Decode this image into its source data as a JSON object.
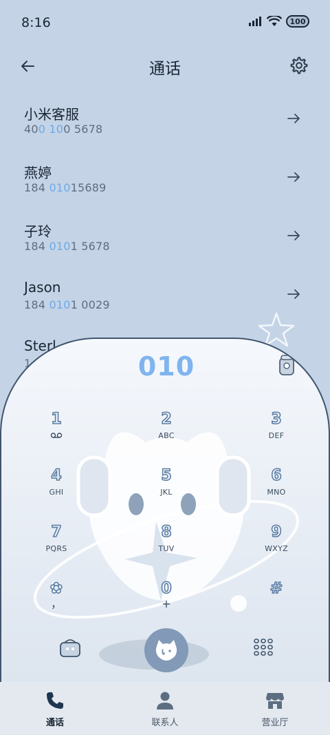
{
  "status": {
    "time": "8:16",
    "battery": "100"
  },
  "header": {
    "title": "通话"
  },
  "contacts": [
    {
      "name": "小米客服",
      "num_pre": "40",
      "num_hl": "0 10",
      "num_post": "0 5678"
    },
    {
      "name": "燕婷",
      "num_pre": "184 ",
      "num_hl": "010",
      "num_post": "15689"
    },
    {
      "name": "子玲",
      "num_pre": "184 ",
      "num_hl": "010",
      "num_post": "1 5678"
    },
    {
      "name": "Jason",
      "num_pre": "184 ",
      "num_hl": "010",
      "num_post": "1 0029"
    },
    {
      "name": "Sterl",
      "num_pre": "1",
      "num_hl": "",
      "num_post": ""
    }
  ],
  "dialer": {
    "input": "010",
    "keys": [
      {
        "digit": "1",
        "letters": "",
        "icon": "voicemail-icon"
      },
      {
        "digit": "2",
        "letters": "ABC"
      },
      {
        "digit": "3",
        "letters": "DEF"
      },
      {
        "digit": "4",
        "letters": "GHI"
      },
      {
        "digit": "5",
        "letters": "JKL"
      },
      {
        "digit": "6",
        "letters": "MNO"
      },
      {
        "digit": "7",
        "letters": "PQRS"
      },
      {
        "digit": "8",
        "letters": "TUV"
      },
      {
        "digit": "9",
        "letters": "WXYZ"
      },
      {
        "digit": "✿",
        "letters": "，"
      },
      {
        "digit": "0",
        "letters": "+"
      },
      {
        "digit": "#",
        "letters": ""
      }
    ]
  },
  "tabs": [
    {
      "label": "通话",
      "icon": "phone-icon",
      "active": true
    },
    {
      "label": "联系人",
      "icon": "person-icon",
      "active": false
    },
    {
      "label": "营业厅",
      "icon": "store-icon",
      "active": false
    }
  ],
  "colors": {
    "accent": "#7fb4ee",
    "background": "#c4d4e6",
    "call_button": "#8299b7"
  }
}
